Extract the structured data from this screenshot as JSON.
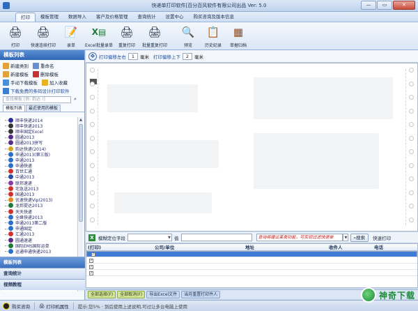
{
  "window": {
    "title": "快递单打印软件[百分百风软件有限公司出品  Ver: 5.0",
    "controls": [
      "—",
      "▭",
      "✕"
    ]
  },
  "menu": {
    "tabs": [
      "打印",
      "模板管理",
      "数据导入",
      "客户及价格管理",
      "查询统计",
      "设置中心",
      "购买咨询及版本信息"
    ],
    "active": "打印"
  },
  "ribbon": {
    "buttons": [
      {
        "label": "打印",
        "icon": "printer-icon"
      },
      {
        "label": "快速连续打印",
        "icon": "fast-print-icon"
      },
      {
        "label": "录单",
        "icon": "form-entry-icon"
      },
      {
        "label": "Excel批量录单",
        "icon": "excel-import-icon"
      },
      {
        "label": "重复打印",
        "icon": "reprint-icon"
      },
      {
        "label": "批量重复打印",
        "icon": "batch-reprint-icon"
      },
      {
        "label": "预览",
        "icon": "magnifier-icon"
      },
      {
        "label": "历史纪录",
        "icon": "history-icon"
      },
      {
        "label": "单据归档",
        "icon": "archive-box-icon"
      }
    ]
  },
  "sidebar": {
    "header": "模板列表",
    "actions": [
      {
        "label": "新建类别",
        "color": "#e2a23b"
      },
      {
        "label": "重命名",
        "color": "#6a8fd0"
      },
      {
        "label": "新建模板",
        "color": "#e2a23b"
      },
      {
        "label": "删除模板",
        "color": "#c83232"
      },
      {
        "label": "手动下载模板",
        "color": "#4a90d9"
      },
      {
        "label": "加入收藏",
        "color": "#e6b422"
      },
      {
        "label": "下载免费的条码设计打印软件",
        "color": "#3c7fd0"
      }
    ],
    "search_placeholder": "查找模板 [例: 韵达 !]",
    "tabs": [
      "模板列表",
      "最近使用的模板"
    ],
    "templates": [
      {
        "name": "顺丰快递2014",
        "color": "#2a2a9a"
      },
      {
        "name": "顺丰快递2013",
        "color": "#333"
      },
      {
        "name": "顺丰国定Excel",
        "color": "#333"
      },
      {
        "name": "圆通2013",
        "color": "#5a2a8a"
      },
      {
        "name": "圆通2013拼写",
        "color": "#5a2a8a"
      },
      {
        "name": "韵达快递(2014)",
        "color": "#d4a21f"
      },
      {
        "name": "申通2013(第三版)",
        "color": "#2a6fc7"
      },
      {
        "name": "申通2013",
        "color": "#2a6fc7"
      },
      {
        "name": "申通快递",
        "color": "#2a6fc7"
      },
      {
        "name": "百世汇通",
        "color": "#d03030"
      },
      {
        "name": "中通2013",
        "color": "#2a4fa7"
      },
      {
        "name": "联邦速递",
        "color": "#8a3aa7"
      },
      {
        "name": "宅急送2013",
        "color": "#d03030"
      },
      {
        "name": "国通2013",
        "color": "#d03030"
      },
      {
        "name": "优速快递Vip(2013)",
        "color": "#e08a20"
      },
      {
        "name": "龙邦提达2013",
        "color": "#1f7a3a"
      },
      {
        "name": "天天快递",
        "color": "#d03030"
      },
      {
        "name": "全峰快递2013",
        "color": "#2a6fc7"
      },
      {
        "name": "申通2013第二版",
        "color": "#2a6fc7"
      },
      {
        "name": "申通国定",
        "color": "#2a6fc7"
      },
      {
        "name": "汇通2013",
        "color": "#d03030"
      },
      {
        "name": "圆通速递",
        "color": "#5a2a8a"
      },
      {
        "name": "国际EMS国际运单",
        "color": "#1f7a3a"
      },
      {
        "name": "运通申通快递2013",
        "color": "#2a6fc7"
      }
    ],
    "panels": [
      "模板列表",
      "查询统计",
      "视频教程"
    ]
  },
  "main": {
    "offset_x_label": "打印偏移左右",
    "offset_x_value": "1",
    "offset_x_unit": "毫米",
    "offset_y_label": "打印偏移上下",
    "offset_y_value": "2",
    "offset_y_unit": "毫米"
  },
  "filter": {
    "field_label": "模糊定位字段",
    "value_label": "值",
    "hint_text": "查询将建议某类功能，可实现过滤快递单",
    "search_button": "搜索",
    "fast_print_label": "快速打印"
  },
  "grid": {
    "columns": [
      "(打印)",
      "公司/单位",
      "地址",
      "收件人",
      "电话"
    ],
    "rows": 4
  },
  "bottom_tabs": [
    {
      "label": "全部选择(F)",
      "style": "g"
    },
    {
      "label": "全部取消(F)",
      "style": "g"
    },
    {
      "label": "导出Excel文件",
      "style": "b"
    },
    {
      "label": "当月重置打印件人",
      "style": "b"
    }
  ],
  "status": {
    "contact": "购买咨询",
    "print_props": "打印机属性",
    "message": "提示:您5% · 到后使用上述说明,可过让多台电脑上使用"
  },
  "watermark": {
    "text": "神奇下载"
  }
}
